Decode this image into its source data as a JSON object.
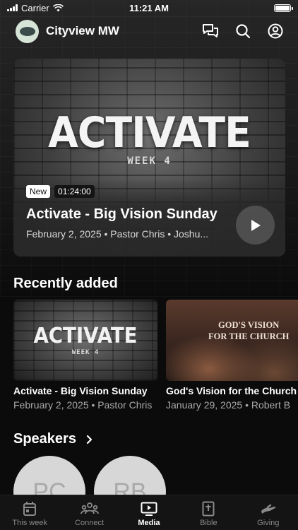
{
  "status_bar": {
    "carrier": "Carrier",
    "time": "11:21 AM",
    "battery_level": 1.0
  },
  "header": {
    "app_name": "Cityview MW",
    "icons": [
      "chat-icon",
      "search-icon",
      "profile-icon"
    ]
  },
  "hero": {
    "art_title": "ACTIVATE",
    "art_week": "WEEK 4",
    "badge_new": "New",
    "duration": "01:24:00",
    "title": "Activate - Big Vision Sunday",
    "meta": "February 2, 2025 • Pastor Chris • Joshu..."
  },
  "recently_added": {
    "title": "Recently added",
    "items": [
      {
        "art_title": "ACTIVATE",
        "art_week": "WEEK 4",
        "title": "Activate - Big Vision Sunday",
        "meta": "February 2, 2025 • Pastor Chris"
      },
      {
        "art_title_line1": "GOD'S VISION",
        "art_title_line2": "FOR THE CHURCH",
        "title": "God's Vision for the Church",
        "meta": "January 29, 2025 • Robert B"
      }
    ]
  },
  "speakers": {
    "title": "Speakers",
    "items": [
      {
        "initials": "PC"
      },
      {
        "initials": "RB"
      }
    ]
  },
  "tab_bar": {
    "active": "Media",
    "items": [
      {
        "label": "This week",
        "icon": "calendar-icon"
      },
      {
        "label": "Connect",
        "icon": "people-icon"
      },
      {
        "label": "Media",
        "icon": "tv-play-icon"
      },
      {
        "label": "Bible",
        "icon": "bible-icon"
      },
      {
        "label": "Giving",
        "icon": "giving-hand-icon"
      }
    ]
  }
}
